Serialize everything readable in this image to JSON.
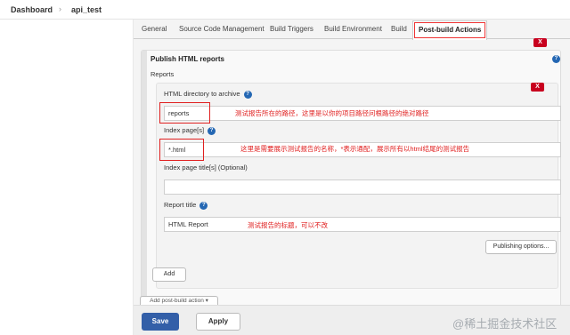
{
  "breadcrumb": {
    "dashboard": "Dashboard",
    "separator": "›",
    "job": "api_test"
  },
  "tabs": [
    {
      "label": "General"
    },
    {
      "label": "Source Code Management"
    },
    {
      "label": "Build Triggers"
    },
    {
      "label": "Build Environment"
    },
    {
      "label": "Build"
    },
    {
      "label": "Post-build Actions",
      "active": true
    }
  ],
  "publish": {
    "title": "Publish HTML reports",
    "close_label": "X",
    "reports_label": "Reports",
    "item_close_label": "X",
    "html_dir": {
      "label": "HTML directory to archive",
      "value": "reports",
      "annotation": "测试报告所在的路径，这里是以你的项目路径问根路径的绝对路径"
    },
    "index_page": {
      "label": "Index page[s]",
      "value": "*.html",
      "annotation": "这里是需要展示测试报告的名称，*表示通配，展示所有以html结尾的测试报告"
    },
    "index_title": {
      "label": "Index page title[s] (Optional)",
      "value": ""
    },
    "report_title": {
      "label": "Report title",
      "value": "HTML Report",
      "annotation": "测试报告的标题，可以不改"
    },
    "help_glyph": "?",
    "publishing_options": "Publishing options...",
    "add": "Add"
  },
  "add_post_build": "Add post-build action ▾",
  "save": "Save",
  "apply": "Apply",
  "watermark": "@稀土掘金技术社区",
  "colors": {
    "save_bg": "#335fa8",
    "close_bg": "#c8001e",
    "annotation": "#e02020",
    "help_bg": "#2467b3"
  }
}
